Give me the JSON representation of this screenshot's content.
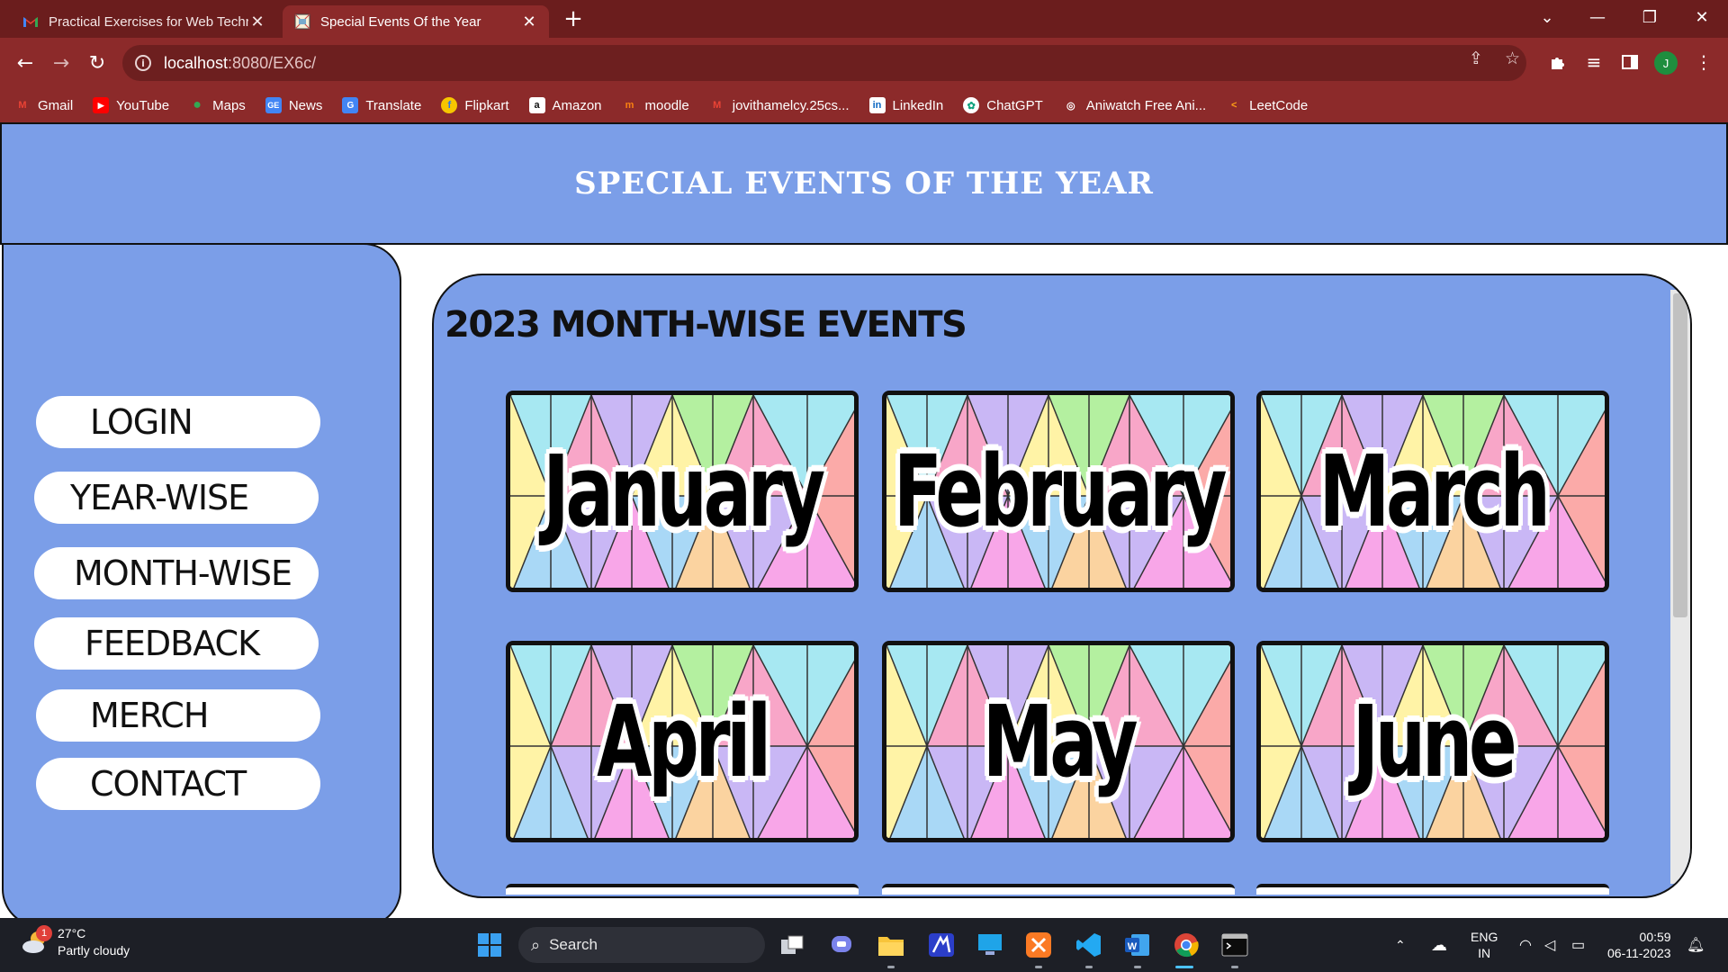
{
  "browser": {
    "tabs": [
      {
        "title": "Practical Exercises for Web Techr",
        "active": false
      },
      {
        "title": "Special Events Of the Year",
        "active": true
      }
    ],
    "url_host": "localhost",
    "url_path": ":8080/EX6c/",
    "profile_initial": "J",
    "bookmarks": [
      {
        "label": "Gmail",
        "icon": "gmail-icon"
      },
      {
        "label": "YouTube",
        "icon": "youtube-icon"
      },
      {
        "label": "Maps",
        "icon": "maps-icon"
      },
      {
        "label": "News",
        "icon": "news-icon"
      },
      {
        "label": "Translate",
        "icon": "translate-icon"
      },
      {
        "label": "Flipkart",
        "icon": "flipkart-icon"
      },
      {
        "label": "Amazon",
        "icon": "amazon-icon"
      },
      {
        "label": "moodle",
        "icon": "moodle-icon"
      },
      {
        "label": "jovithamelcy.25cs...",
        "icon": "gmail-icon"
      },
      {
        "label": "LinkedIn",
        "icon": "linkedin-icon"
      },
      {
        "label": "ChatGPT",
        "icon": "chatgpt-icon"
      },
      {
        "label": "Aniwatch Free Ani...",
        "icon": "aniwatch-icon"
      },
      {
        "label": "LeetCode",
        "icon": "leetcode-icon"
      }
    ]
  },
  "page": {
    "header_title": "SPECIAL EVENTS OF THE YEAR",
    "nav": [
      "LOGIN",
      "YEAR-WISE",
      "MONTH-WISE",
      "FEEDBACK",
      "MERCH",
      "CONTACT"
    ],
    "events_heading": "2023 MONTH-WISE EVENTS",
    "months": [
      "January",
      "February",
      "March",
      "April",
      "May",
      "June"
    ]
  },
  "taskbar": {
    "weather_temp": "27°C",
    "weather_desc": "Partly cloudy",
    "weather_badge": "1",
    "search_label": "Search",
    "lang_primary": "ENG",
    "lang_secondary": "IN",
    "time": "00:59",
    "date": "06-11-2023"
  },
  "colors": {
    "chrome": "#8c2a2a",
    "tabstrip": "#6b1d1d",
    "page_blue": "#7b9ee8",
    "taskbar": "#1d1f26"
  }
}
